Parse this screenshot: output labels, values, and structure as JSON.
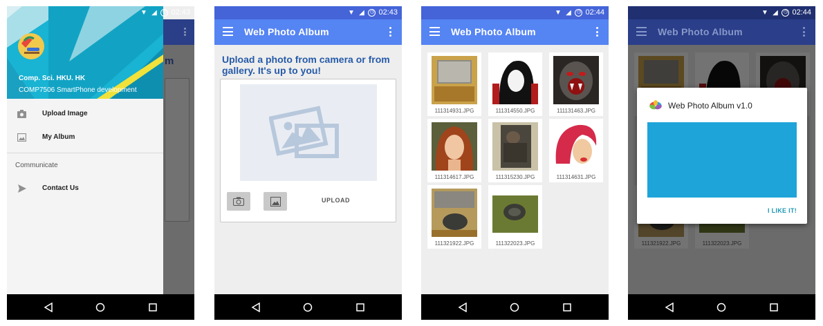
{
  "statusbar": {
    "time_1": "02:43",
    "time_2": "02:43",
    "time_3": "02:44",
    "time_4": "02:44"
  },
  "app": {
    "title": "Web Photo Album"
  },
  "drawer": {
    "user_name": "Comp. Sci. HKU. HK",
    "user_subtitle": "COMP7506 SmartPhone development",
    "items": [
      {
        "label": "Upload Image",
        "icon": "camera-icon"
      },
      {
        "label": "My Album",
        "icon": "image-icon"
      }
    ],
    "section_title": "Communicate",
    "contact_label": "Contact Us",
    "background_partial_title": "m"
  },
  "upload": {
    "heading": "Upload a photo from camera or from gallery. It's up to you!",
    "upload_label": "UPLOAD"
  },
  "album": {
    "photos": [
      {
        "caption": "111314931.JPG"
      },
      {
        "caption": "111314550.JPG"
      },
      {
        "caption": "111131463.JPG"
      },
      {
        "caption": "111314617.JPG"
      },
      {
        "caption": "111315230.JPG"
      },
      {
        "caption": "111314631.JPG"
      },
      {
        "caption": "111321922.JPG"
      },
      {
        "caption": "111322023.JPG"
      }
    ]
  },
  "dialog": {
    "title": "Web Photo Album v1.0",
    "button_label": "I LIKE IT!"
  },
  "colors": {
    "primary": "#5584f3",
    "status": "#4464d8",
    "dialog_accent": "#1ea4d9"
  }
}
